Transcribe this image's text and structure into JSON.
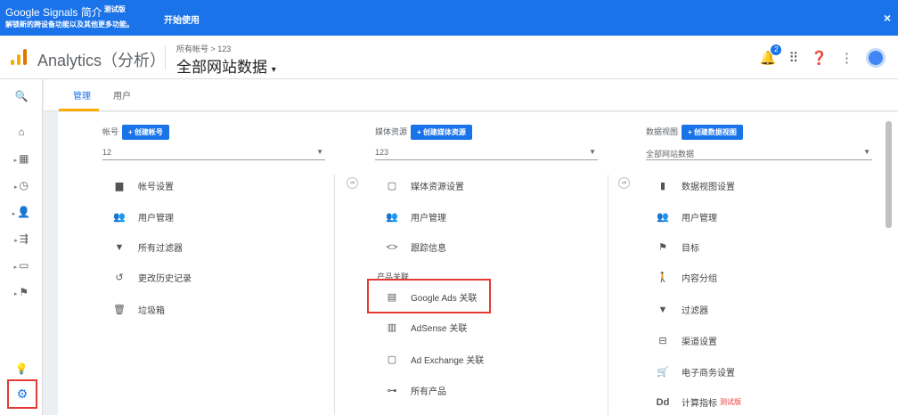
{
  "banner": {
    "title": "Google Signals 简介",
    "beta": "测试版",
    "subtitle": "解锁新的跨设备功能以及其他更多功能。",
    "start": "开始使用",
    "close": "×"
  },
  "header": {
    "app_name": "Analytics（分析）",
    "breadcrumb": "所有帐号 > 123",
    "view": "全部网站数据",
    "notif_count": "2"
  },
  "tabs": [
    {
      "label": "管理"
    },
    {
      "label": "用户"
    }
  ],
  "accent": "#1a73e8",
  "columns": {
    "account": {
      "label": "帐号",
      "create": "+ 创建帐号",
      "selected": "12",
      "items": [
        "帐号设置",
        "用户管理",
        "所有过滤器",
        "更改历史记录",
        "垃圾箱"
      ]
    },
    "property": {
      "label": "媒体资源",
      "create": "+ 创建媒体资源",
      "selected": "123",
      "items": [
        "媒体资源设置",
        "用户管理",
        "跟踪信息"
      ],
      "section": "产品关联",
      "links": [
        "Google Ads 关联",
        "AdSense 关联",
        "Ad Exchange 关联",
        "所有产品"
      ]
    },
    "view": {
      "label": "数据视图",
      "create": "+ 创建数据视图",
      "selected": "全部网站数据",
      "items": [
        "数据视图设置",
        "用户管理",
        "目标",
        "内容分组",
        "过滤器",
        "渠道设置",
        "电子商务设置",
        "计算指标"
      ],
      "beta": "测试版"
    }
  }
}
